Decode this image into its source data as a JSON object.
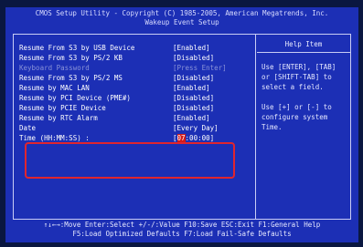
{
  "header": {
    "title": "CMOS Setup Utility - Copyright (C) 1985-2005, American Megatrends, Inc.",
    "subtitle": "Wakeup Event Setup"
  },
  "settings": [
    {
      "label": "Resume From S3 by USB Device",
      "value": "[Enabled]",
      "enabled": true
    },
    {
      "label": "Resume From S3 by PS/2 KB",
      "value": "[Disabled]",
      "enabled": true
    },
    {
      "label": "Keyboard Password",
      "value": "[Press Enter]",
      "enabled": false
    },
    {
      "label": "Resume From S3 by PS/2 MS",
      "value": "[Disabled]",
      "enabled": true
    },
    {
      "label": "Resume by MAC LAN",
      "value": "[Enabled]",
      "enabled": true
    },
    {
      "label": "Resume by PCI Device (PME#)",
      "value": "[Disabled]",
      "enabled": true
    },
    {
      "label": "Resume by PCIE Device",
      "value": "[Disabled]",
      "enabled": true
    },
    {
      "label": "Resume by RTC Alarm",
      "value": "[Enabled]",
      "enabled": true
    },
    {
      "label": "Date",
      "value": "[Every Day]",
      "enabled": true
    },
    {
      "label": "Time (HH:MM:SS) :",
      "value_prefix": "[",
      "value_cursor": "07",
      "value_suffix": ":00:00]",
      "enabled": true
    }
  ],
  "help": {
    "title": "Help Item",
    "text1": "Use [ENTER], [TAB]\nor [SHIFT-TAB] to\nselect a field.",
    "text2": "Use [+] or [-] to\nconfigure system Time."
  },
  "footer": {
    "line1": "↑↓←→:Move  Enter:Select  +/-/:Value  F10:Save  ESC:Exit  F1:General Help",
    "line2": "F5:Load Optimized Defaults          F7:Load Fail-Safe Defaults"
  },
  "colors": {
    "background": "#1c2fb5",
    "highlight": "#e0252e",
    "cursor": "#d11a1a"
  }
}
